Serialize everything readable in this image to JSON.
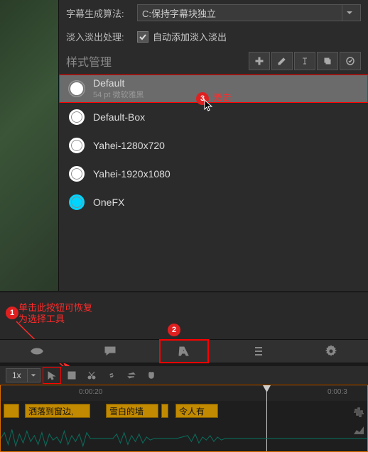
{
  "algo": {
    "label": "字幕生成算法:",
    "value": "C:保持字幕块独立"
  },
  "fade": {
    "label": "淡入淡出处理:",
    "checkbox_label": "自动添加淡入淡出",
    "checked": true
  },
  "style_manager": {
    "title": "样式管理",
    "tools": [
      "add",
      "edit",
      "text",
      "copy",
      "confirm"
    ],
    "items": [
      {
        "name": "Default",
        "sub": "54 pt 微软雅黑",
        "selected": true,
        "color": "white"
      },
      {
        "name": "Default-Box",
        "sub": "",
        "selected": false,
        "color": "white"
      },
      {
        "name": "Yahei-1280x720",
        "sub": "",
        "selected": false,
        "color": "white"
      },
      {
        "name": "Yahei-1920x1080",
        "sub": "",
        "selected": false,
        "color": "white"
      },
      {
        "name": "OneFX",
        "sub": "",
        "selected": false,
        "color": "cyan"
      }
    ]
  },
  "annotations": {
    "a1": {
      "num": "1",
      "text": "单击此按钮可恢复\n为选择工具"
    },
    "a2": {
      "num": "2"
    },
    "a3": {
      "num": "3",
      "text": "双击"
    }
  },
  "toolbar2": {
    "zoom": "1x"
  },
  "timeline": {
    "times": [
      "0:00:20",
      "0:00:3"
    ],
    "clips": [
      "洒落到窗边,",
      "雪白的墙",
      "令人有"
    ]
  }
}
